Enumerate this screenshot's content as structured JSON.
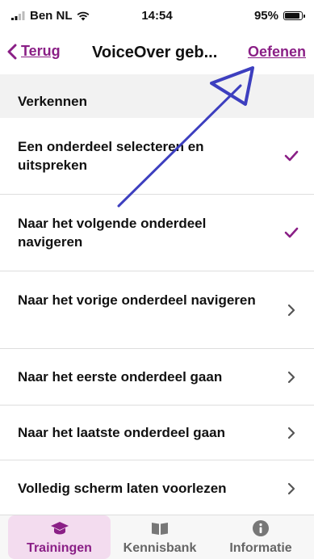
{
  "status_bar": {
    "carrier": "Ben NL",
    "time": "14:54",
    "battery": "95%",
    "battery_level": 0.95
  },
  "nav": {
    "back_label": "Terug",
    "title": "VoiceOver geb...",
    "practice_label": "Oefenen"
  },
  "section": {
    "title": "Verkennen"
  },
  "rows": [
    {
      "label": "Een onderdeel selecteren en uitspreken",
      "status": "completed"
    },
    {
      "label": "Naar het volgende onderdeel navigeren",
      "status": "completed"
    },
    {
      "label": "Naar het vorige onderdeel navigeren",
      "status": "open"
    },
    {
      "label": "Naar het eerste onderdeel gaan",
      "status": "open"
    },
    {
      "label": "Naar het laatste onderdeel gaan",
      "status": "open"
    },
    {
      "label": "Volledig scherm laten voorlezen",
      "status": "open"
    }
  ],
  "tabs": [
    {
      "label": "Trainingen",
      "icon": "graduation-cap-icon",
      "active": true
    },
    {
      "label": "Kennisbank",
      "icon": "book-icon",
      "active": false
    },
    {
      "label": "Informatie",
      "icon": "info-icon",
      "active": false
    }
  ],
  "colors": {
    "accent": "#8a1f86",
    "annotation_arrow": "#3d3fbf",
    "background": "#f2f2f2",
    "active_tab_bg": "#f3dcef"
  }
}
